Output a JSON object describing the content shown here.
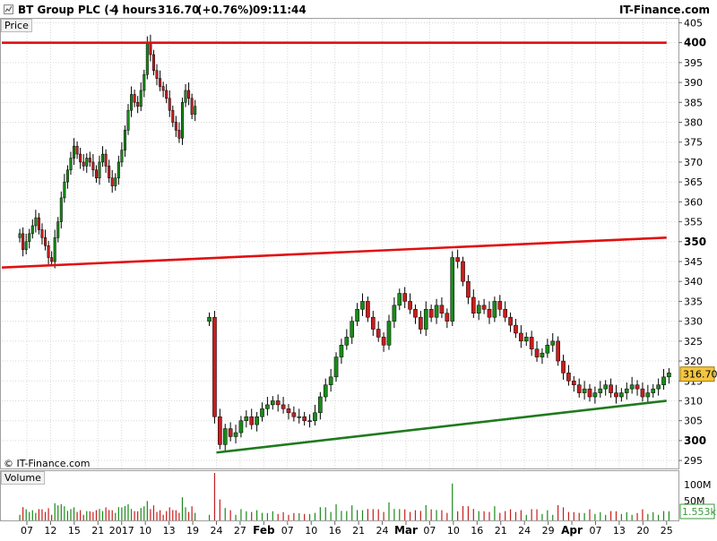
{
  "header": {
    "symbol": "BT Group PLC (-)",
    "timeframe": "4 hours",
    "last": "316.70",
    "change": "(+0.76%)",
    "time": "09:11:44",
    "brand": "IT-Finance.com"
  },
  "panels": {
    "price_label": "Price",
    "volume_label": "Volume"
  },
  "watermark": "© IT-Finance.com",
  "colors": {
    "up": "#1a8a1a",
    "down": "#c61e1e",
    "resistance": "#e01010",
    "support": "#1f7a1f",
    "grid": "#d8d8d8",
    "last_badge_bg": "#f4c542"
  },
  "chart_data": {
    "type": "candlestick",
    "title": "BT Group PLC (-)",
    "period": "4 hours",
    "last_price": "316.70",
    "ylim": [
      293,
      406
    ],
    "y_ticks": [
      295,
      300,
      305,
      310,
      315,
      320,
      325,
      330,
      335,
      340,
      345,
      350,
      355,
      360,
      365,
      370,
      375,
      380,
      385,
      390,
      395,
      400,
      405
    ],
    "y_ticks_bold": [
      300,
      350,
      400
    ],
    "volume_ticks": [
      "100M",
      "50M"
    ],
    "volume_last": "1.553k",
    "x_tick_labels": [
      "07",
      "12",
      "15",
      "21",
      "2017",
      "10",
      "13",
      "19",
      "24",
      "27",
      "Feb",
      "07",
      "10",
      "16",
      "21",
      "24",
      "Mar",
      "07",
      "10",
      "16",
      "21",
      "24",
      "29",
      "Apr",
      "07",
      "13",
      "20",
      "25"
    ],
    "segments": [
      {
        "name": "segment-1",
        "x_start": "07",
        "x_end": "19",
        "points": [
          352,
          348,
          350,
          352,
          354,
          356,
          353,
          351,
          349,
          346,
          345,
          351,
          355,
          361,
          365,
          368,
          371,
          374,
          372,
          370,
          369,
          371,
          370,
          368,
          366,
          370,
          372,
          369,
          366,
          364,
          366,
          370,
          373,
          378,
          383,
          387,
          385,
          384,
          388,
          392,
          400,
          397,
          393,
          391,
          389,
          388,
          386,
          383,
          380,
          378,
          376,
          385,
          388,
          386,
          382,
          384
        ]
      },
      {
        "name": "segment-2",
        "x_start": "24",
        "x_end": "25",
        "points": [
          331,
          306,
          299,
          303,
          301,
          302,
          305,
          306,
          304,
          306,
          308,
          309,
          310,
          309,
          308,
          307,
          306,
          306,
          305,
          305,
          307,
          311,
          314,
          316,
          321,
          324,
          326,
          330,
          333,
          335,
          331,
          328,
          326,
          324,
          330,
          334,
          337,
          335,
          333,
          331,
          328,
          333,
          331,
          334,
          332,
          330,
          346,
          345,
          340,
          336,
          332,
          334,
          333,
          331,
          335,
          333,
          331,
          329,
          327,
          325,
          326,
          323,
          321,
          322,
          324,
          325,
          320,
          317,
          315,
          314,
          312,
          313,
          311,
          312,
          313,
          314,
          312,
          311,
          312,
          313,
          314,
          313,
          311,
          312,
          313,
          314,
          316,
          317
        ]
      }
    ],
    "trendlines": [
      {
        "name": "resistance-top",
        "x_start": "07",
        "y_start": 400,
        "x_end": "25",
        "y_end": 400,
        "color": "#e01010"
      },
      {
        "name": "resistance-mid",
        "x_start": "07",
        "y_start": 343.5,
        "x_end": "25",
        "y_end": 351,
        "color": "#e01010"
      },
      {
        "name": "support",
        "x_start": "24",
        "y_start": 297,
        "x_end": "25",
        "y_end": 310,
        "color": "#1f7a1f"
      }
    ]
  }
}
